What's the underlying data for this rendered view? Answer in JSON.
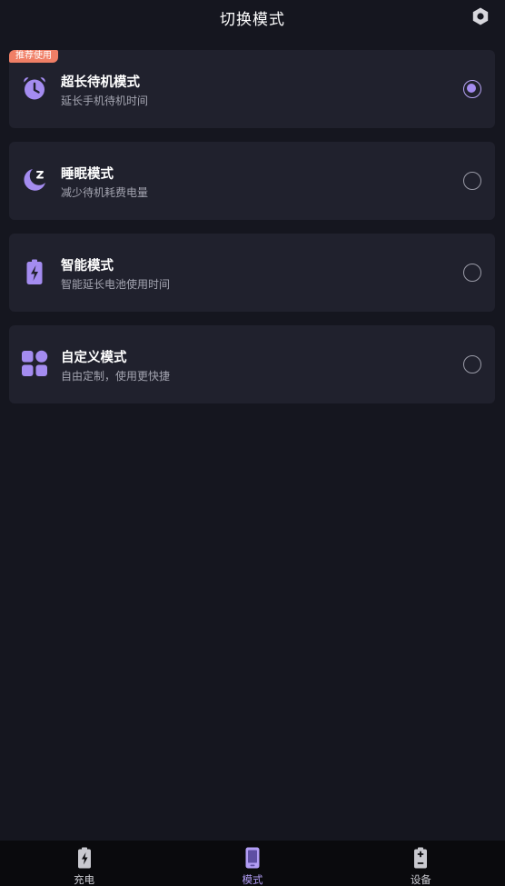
{
  "header": {
    "title": "切换模式",
    "settings_icon": "gear-icon"
  },
  "colors": {
    "background": "#15161f",
    "card": "#20212d",
    "accent": "#a48cf0",
    "badge": "#f07f66",
    "nav_background": "#0a0a0d"
  },
  "modes": [
    {
      "title": "超长待机模式",
      "description": "延长手机待机时间",
      "icon": "alarm-clock-icon",
      "selected": true,
      "badge": "推荐使用"
    },
    {
      "title": "睡眠模式",
      "description": "减少待机耗费电量",
      "icon": "moon-sleep-icon",
      "selected": false
    },
    {
      "title": "智能模式",
      "description": "智能延长电池使用时间",
      "icon": "battery-charging-icon",
      "selected": false
    },
    {
      "title": "自定义模式",
      "description": "自由定制，使用更快捷",
      "icon": "apps-grid-icon",
      "selected": false
    }
  ],
  "bottom_nav": [
    {
      "label": "充电",
      "icon": "battery-bolt-icon",
      "active": false
    },
    {
      "label": "模式",
      "icon": "phone-icon",
      "active": true
    },
    {
      "label": "设备",
      "icon": "battery-plus-minus-icon",
      "active": false
    }
  ]
}
